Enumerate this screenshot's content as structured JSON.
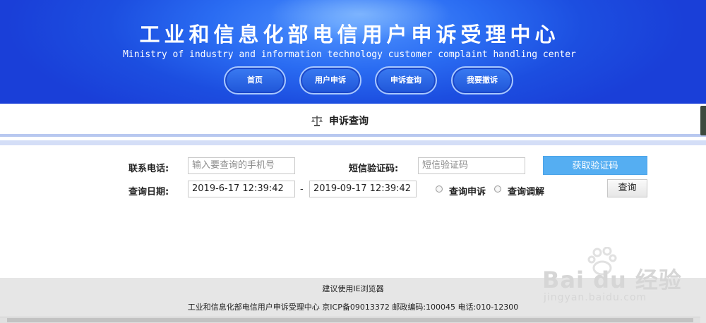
{
  "header": {
    "title": "工业和信息化部电信用户申诉受理中心",
    "subtitle": "Ministry of industry and information technology customer complaint handling center",
    "nav": [
      {
        "label": "首页"
      },
      {
        "label": "用户申诉"
      },
      {
        "label": "申诉查询"
      },
      {
        "label": "我要撤诉"
      }
    ]
  },
  "section": {
    "title": "申诉查询",
    "icon": "scale-icon"
  },
  "form": {
    "phone_label": "联系电话:",
    "phone_placeholder": "输入要查询的手机号",
    "sms_label": "短信验证码:",
    "sms_placeholder": "短信验证码",
    "get_code_label": "获取验证码",
    "date_label": "查询日期:",
    "date_from": "2019-6-17 12:39:42",
    "date_separator": "-",
    "date_to": "2019-09-17 12:39:42",
    "radio_complaint_label": "查询申诉",
    "radio_mediation_label": "查询调解",
    "query_label": "查询"
  },
  "footer": {
    "browser_hint": "建议使用IE浏览器",
    "info": "工业和信息化部电信用户申诉受理中心 京ICP备09013372 邮政编码:100045 电话:010-12300"
  },
  "watermark": {
    "brand": "Bai du 经验",
    "url": "jingyan.baidu.com"
  },
  "colors": {
    "header_blue": "#1c4ee0",
    "button_blue": "#55aef2",
    "footer_gray": "#e6e6e6"
  }
}
